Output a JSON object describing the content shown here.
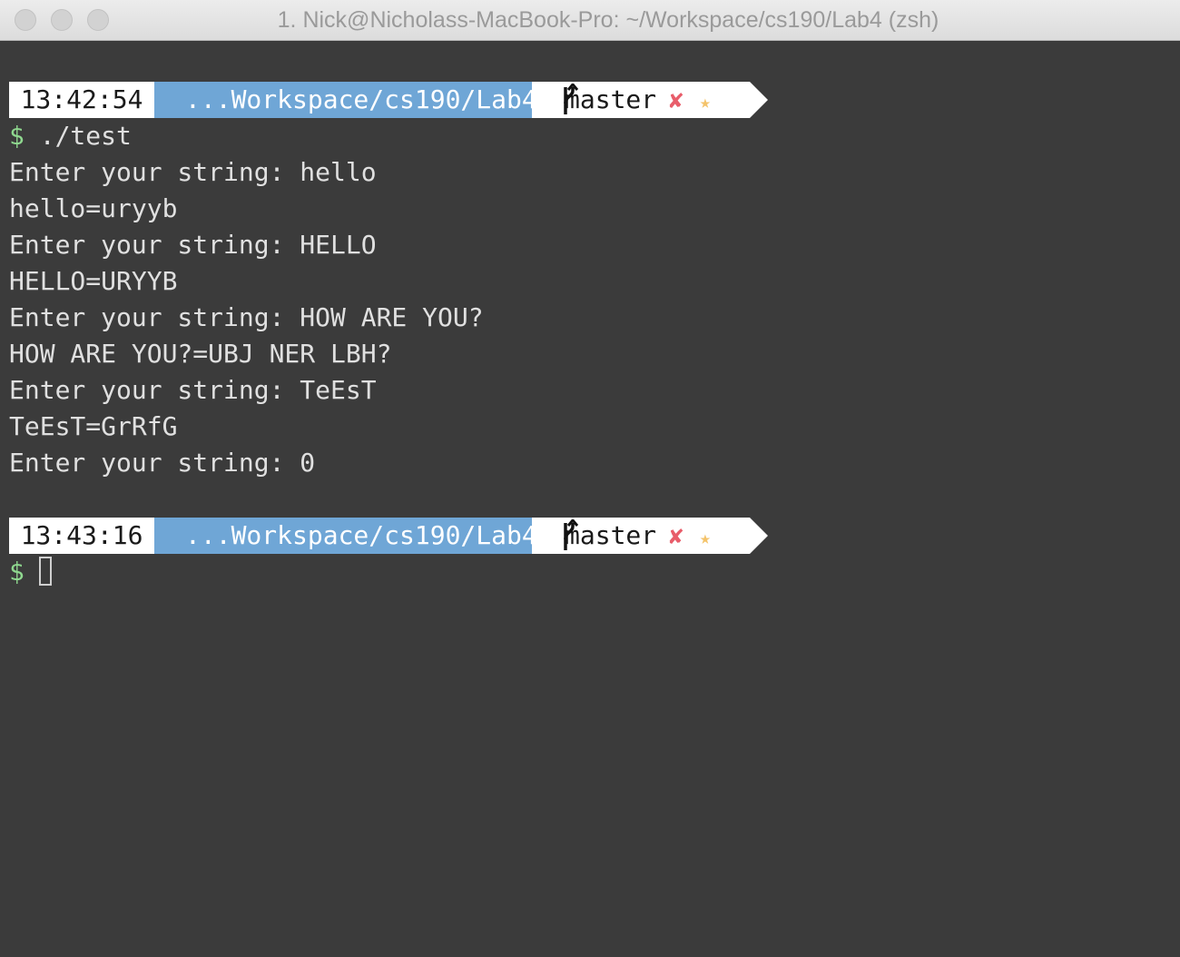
{
  "window": {
    "title": "1. Nick@Nicholass-MacBook-Pro: ~/Workspace/cs190/Lab4 (zsh)"
  },
  "colors": {
    "background": "#3b3b3b",
    "path_segment": "#6fa6d6",
    "time_segment": "#ffffff",
    "dollar": "#8fd88f",
    "git_dirty": "#e85d6a",
    "git_star": "#f4c36a"
  },
  "prompt1": {
    "time": "13:42:54",
    "path": "...Workspace/cs190/Lab4",
    "branch_icon": "git-branch-icon",
    "branch": "master",
    "dirty_mark": "✘",
    "star_mark": "★"
  },
  "command": {
    "prompt_symbol": "$",
    "text": " ./test"
  },
  "output": [
    "Enter your string: hello",
    "hello=uryyb",
    "Enter your string: HELLO",
    "HELLO=URYYB",
    "Enter your string: HOW ARE YOU?",
    "HOW ARE YOU?=UBJ NER LBH?",
    "Enter your string: TeEsT",
    "TeEsT=GrRfG",
    "Enter your string: 0"
  ],
  "prompt2": {
    "time": "13:43:16",
    "path": "...Workspace/cs190/Lab4",
    "branch_icon": "git-branch-icon",
    "branch": "master",
    "dirty_mark": "✘",
    "star_mark": "★"
  },
  "input": {
    "prompt_symbol": "$",
    "value": ""
  }
}
